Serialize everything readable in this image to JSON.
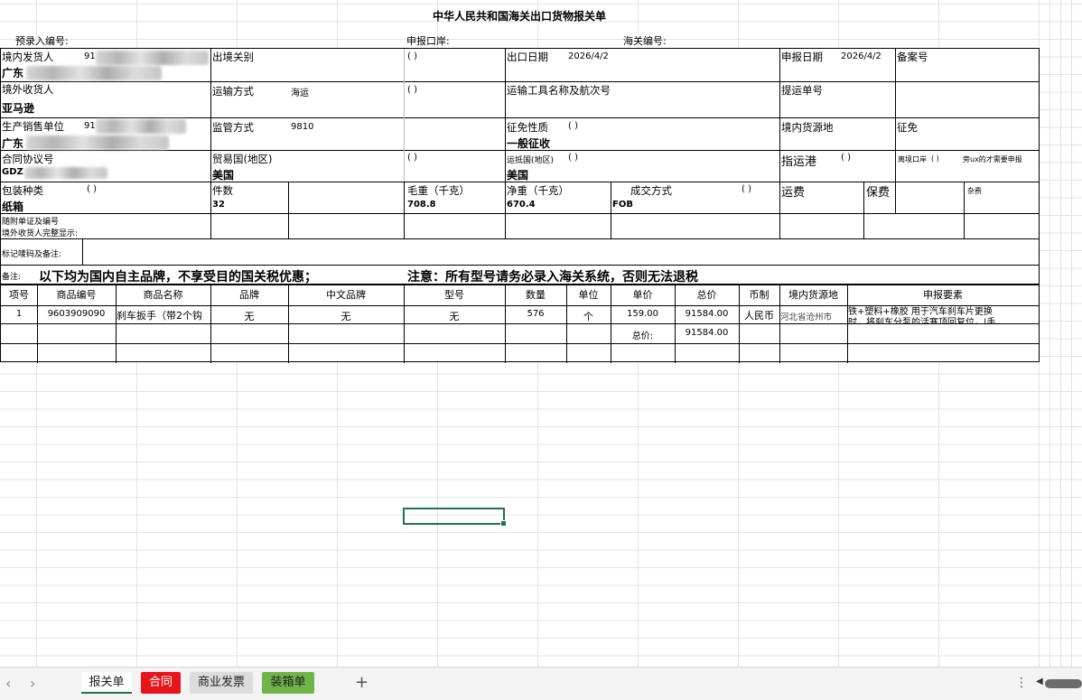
{
  "title": "中华人民共和国海关出口货物报关单",
  "pre_header": {
    "entry_no_label": "预录入编号:",
    "port_label": "申报口岸:",
    "customs_no_label": "海关编号:"
  },
  "form": {
    "shipper_label": "境内发货人",
    "shipper_code": "91",
    "shipper_name": "广东",
    "exit_customs_label": "出境关别",
    "paren": "(    )",
    "paren_short": "( )",
    "export_date_label": "出口日期",
    "export_date": "2026/4/2",
    "declare_date_label": "申报日期",
    "declare_date": "2026/4/2",
    "record_no_label": "备案号",
    "consignee_label": "境外收货人",
    "consignee": "亚马逊",
    "transport_mode_label": "运输方式",
    "transport_mode": "海运",
    "transport_tool_label": "运输工具名称及航次号",
    "bill_no_label": "提运单号",
    "producer_label": "生产销售单位",
    "producer_code": "91",
    "producer_name": "广东",
    "supervision_label": "监管方式",
    "supervision": "9810",
    "levy_nature_label": "征免性质",
    "levy_nature": "一般征收",
    "origin_place_label": "境内货源地",
    "exemption_label": "征免",
    "contract_label": "合同协议号",
    "contract": "GDZ",
    "trade_country_label": "贸易国(地区)",
    "trade_country": "美国",
    "dest_country_label": "运抵国(地区)",
    "dest_country": "美国",
    "port_label": "指运港",
    "departure_port_label": "离境口岸",
    "departure_port_note": "旁ux的才需要申报",
    "package_label": "包装种类",
    "package": "纸箱",
    "pieces_label": "件数",
    "pieces": "32",
    "gross_label": "毛重（千克）",
    "gross": "708.8",
    "net_label": "净重（千克）",
    "net": "670.4",
    "deal_label": "成交方式",
    "deal": "FOB",
    "freight_label": "运费",
    "insurance_label": "保费",
    "misc_label": "杂费",
    "docs_label": "随附单证及编号",
    "buyer_full_label": "境外收货人完整显示:",
    "marks_label": "标记唛码及备注:",
    "remark_label": "备注:",
    "notice1": "以下均为国内自主品牌，不享受目的国关税优惠；",
    "notice2": "注意：所有型号请务必录入海关系统，否则无法退税"
  },
  "table": {
    "headers": [
      "项号",
      "商品编号",
      "商品名称",
      "品牌",
      "中文品牌",
      "型号",
      "数量",
      "单位",
      "单价",
      "总价",
      "币制",
      "境内货源地",
      "申报要素"
    ],
    "row": {
      "item_no": "1",
      "hs_code": "9603909090",
      "name": "刹车扳手（带2个钩",
      "brand": "无",
      "cn_brand": "无",
      "model": "无",
      "qty": "576",
      "unit": "个",
      "unit_price": "159.00",
      "total": "91584.00",
      "currency": "人民币",
      "origin": "河北省沧州市",
      "elements_line1": "铁+塑料+橡胶 用于汽车刹车片更换",
      "elements_line2": "时，将刹车分泵的活塞顶回复位。|手"
    },
    "total_label": "总价:",
    "total_value": "91584.00"
  },
  "tabs": {
    "items": [
      "报关单",
      "合同",
      "商业发票",
      "装箱单"
    ],
    "add": "+",
    "more": "⋮"
  },
  "colors": {
    "grid": "#e3e3e3",
    "selection": "#217346",
    "tab_red": "#e8141b",
    "tab_green": "#6fb54a"
  }
}
